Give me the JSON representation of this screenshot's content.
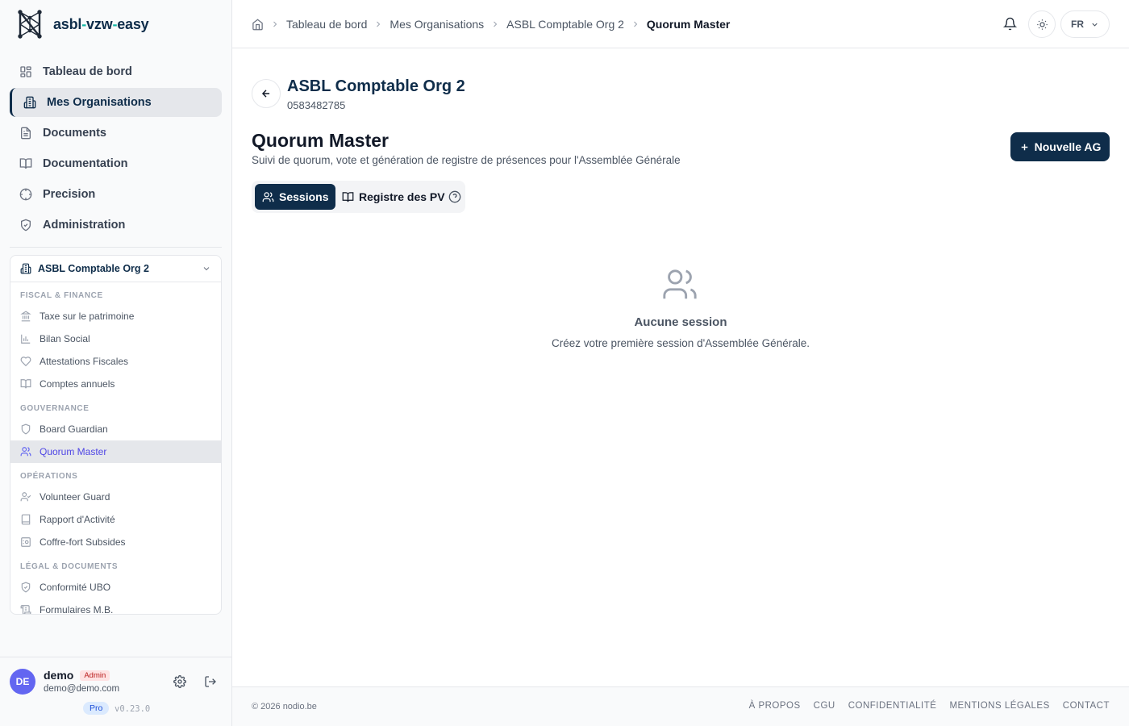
{
  "brand": {
    "prefix": "asbl",
    "mid": "vzw",
    "suffix": "easy",
    "dash": "-"
  },
  "nav": [
    {
      "label": "Tableau de bord",
      "icon": "dashboard-icon"
    },
    {
      "label": "Mes Organisations",
      "icon": "building-icon",
      "active": true
    },
    {
      "label": "Documents",
      "icon": "document-icon"
    },
    {
      "label": "Documentation",
      "icon": "book-icon"
    },
    {
      "label": "Precision",
      "icon": "crosshair-icon"
    },
    {
      "label": "Administration",
      "icon": "shield-icon"
    }
  ],
  "org_panel": {
    "name": "ASBL Comptable Org 2",
    "groups": [
      {
        "title": "FISCAL & FINANCE",
        "items": [
          "Taxe sur le patrimoine",
          "Bilan Social",
          "Attestations Fiscales",
          "Comptes annuels"
        ]
      },
      {
        "title": "GOUVERNANCE",
        "items": [
          "Board Guardian",
          "Quorum Master"
        ]
      },
      {
        "title": "OPÉRATIONS",
        "items": [
          "Volunteer Guard",
          "Rapport d'Activité",
          "Coffre-fort Subsides"
        ]
      },
      {
        "title": "LÉGAL & DOCUMENTS",
        "items": [
          "Conformité UBO",
          "Formulaires M.B."
        ]
      }
    ]
  },
  "user": {
    "initials": "DE",
    "name": "demo",
    "role": "Admin",
    "email": "demo@demo.com",
    "plan": "Pro",
    "version": "v0.23.0"
  },
  "breadcrumb": [
    "Tableau de bord",
    "Mes Organisations",
    "ASBL Comptable Org 2",
    "Quorum Master"
  ],
  "header": {
    "lang": "FR"
  },
  "org": {
    "title": "ASBL Comptable Org 2",
    "number": "0583482785"
  },
  "page": {
    "title": "Quorum Master",
    "subtitle": "Suivi de quorum, vote et génération de registre de présences pour l'Assemblée Générale",
    "new_button": "Nouvelle AG"
  },
  "tabs": {
    "sessions": "Sessions",
    "registry": "Registre des PV"
  },
  "empty": {
    "title": "Aucune session",
    "subtitle": "Créez votre première session d'Assemblée Générale."
  },
  "footer": {
    "copyright": "© 2026 nodio.be",
    "links": [
      "À PROPOS",
      "CGU",
      "CONFIDENTIALITÉ",
      "MENTIONS LÉGALES",
      "CONTACT"
    ]
  },
  "colors": {
    "primary": "#0f2d4a",
    "accent": "#14b8a6",
    "active_sub": "#4f46e5"
  }
}
